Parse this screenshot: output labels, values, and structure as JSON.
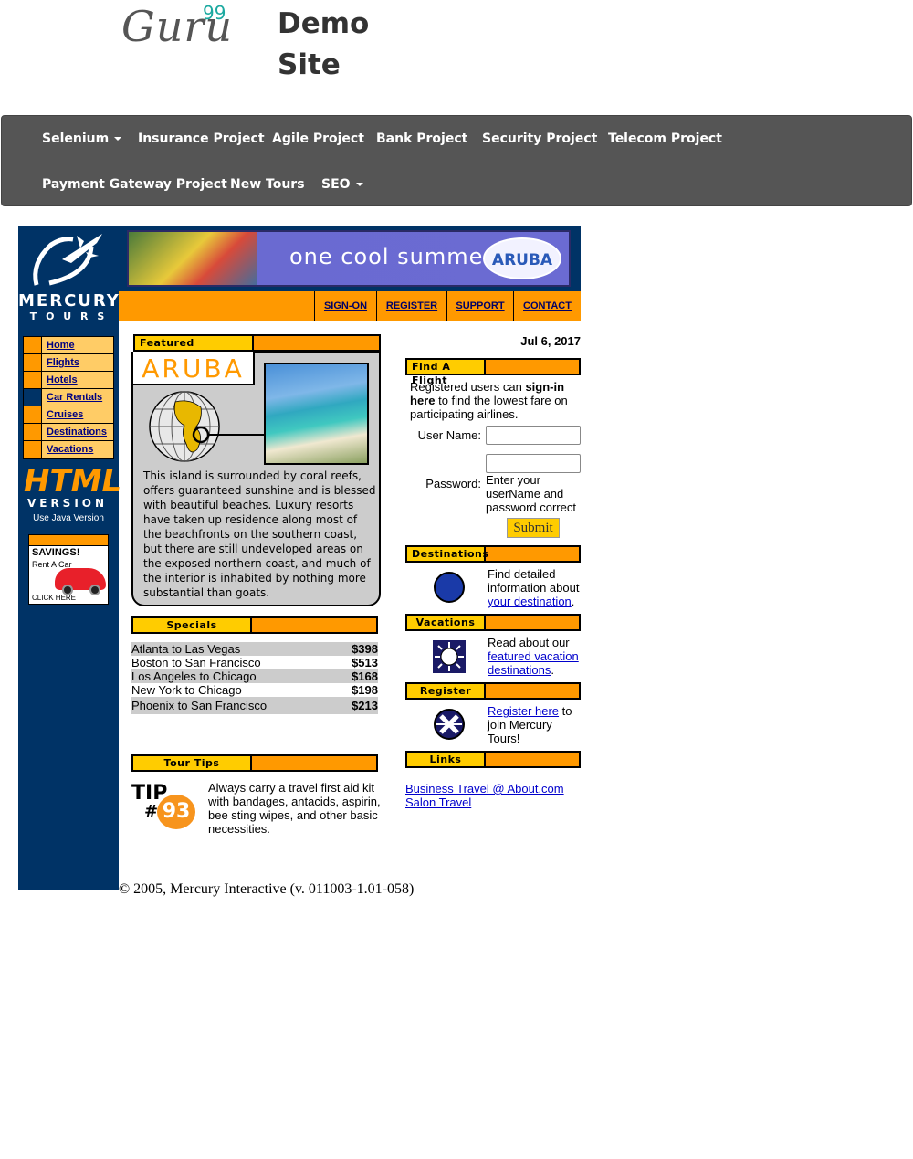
{
  "header": {
    "logo_word": "Guru",
    "logo_sup": "99",
    "title_line1": "Demo",
    "title_line2": "Site"
  },
  "navbar": {
    "items": [
      {
        "label": "Selenium",
        "dropdown": true
      },
      {
        "label": "Insurance Project"
      },
      {
        "label": "Agile Project"
      },
      {
        "label": "Bank Project"
      },
      {
        "label": "Security Project"
      },
      {
        "label": "Telecom Project"
      },
      {
        "label": "Payment Gateway Project"
      },
      {
        "label": "New Tours"
      },
      {
        "label": "SEO",
        "dropdown": true
      }
    ]
  },
  "banner": {
    "text": "one cool summer",
    "badge": "ARUBA"
  },
  "brand": {
    "line1": "MERCURY",
    "line2": "T O U R S"
  },
  "topnav": [
    "SIGN-ON",
    "REGISTER",
    "SUPPORT",
    "CONTACT"
  ],
  "sidenav": [
    "Home",
    "Flights",
    "Hotels",
    "Car Rentals",
    "Cruises",
    "Destinations",
    "Vacations"
  ],
  "side_promo": {
    "html_big": "HTML",
    "html_small": "VERSION",
    "java_link": "Use Java Version",
    "savings": "SAVINGS!",
    "savings_sub": "Rent A Car",
    "click_here": "CLICK HERE"
  },
  "featured": {
    "header": "Featured Destination",
    "name": "ARUBA",
    "text": "This island is surrounded by coral reefs, offers guaranteed sunshine and is blessed with beautiful beaches. Luxury resorts have taken up residence along most of the beachfronts on the southern coast, but there are still undeveloped areas on the exposed northern coast, and much of the interior is inhabited by nothing more substantial than goats."
  },
  "specials": {
    "header": "Specials",
    "rows": [
      {
        "route": "Atlanta to Las Vegas",
        "price": "$398"
      },
      {
        "route": "Boston to San Francisco",
        "price": "$513"
      },
      {
        "route": "Los Angeles to Chicago",
        "price": "$168"
      },
      {
        "route": "New York to Chicago",
        "price": "$198"
      },
      {
        "route": "Phoenix to San Francisco",
        "price": "$213"
      }
    ]
  },
  "tour_tips": {
    "header": "Tour Tips",
    "tip_word": "TIP",
    "tip_hash": "#",
    "tip_number": "93",
    "text": "Always carry a travel first aid kit with bandages, antacids, aspirin, bee sting wipes, and other basic necessities."
  },
  "date": "Jul 6, 2017",
  "find_flight": {
    "header": "Find A Flight",
    "intro_pre": "Registered users can ",
    "intro_bold": "sign-in here",
    "intro_post": " to find the lowest fare on participating airlines.",
    "username_label": "User Name:",
    "password_label": "Password:",
    "username_value": "",
    "password_value": "",
    "hint": "Enter your userName and password correct",
    "submit": "Submit"
  },
  "destinations": {
    "header": "Destinations",
    "text_pre": "Find detailed information about ",
    "link": "your destination",
    "text_post": "."
  },
  "vacations": {
    "header": "Vacations",
    "text_pre": "Read about our ",
    "link": "featured vacation destinations",
    "text_post": "."
  },
  "register": {
    "header": "Register",
    "link": "Register here",
    "text_post": " to join Mercury Tours!"
  },
  "links": {
    "header": "Links",
    "items": [
      "Business Travel @ About.com",
      "Salon Travel"
    ]
  },
  "footer": "© 2005, Mercury Interactive (v. 011003-1.01-058)",
  "colors": {
    "navy": "#003366",
    "orange": "#ff9900",
    "yellow": "#ffcc00",
    "navbar": "#555555",
    "teal": "#1ba9a0"
  }
}
